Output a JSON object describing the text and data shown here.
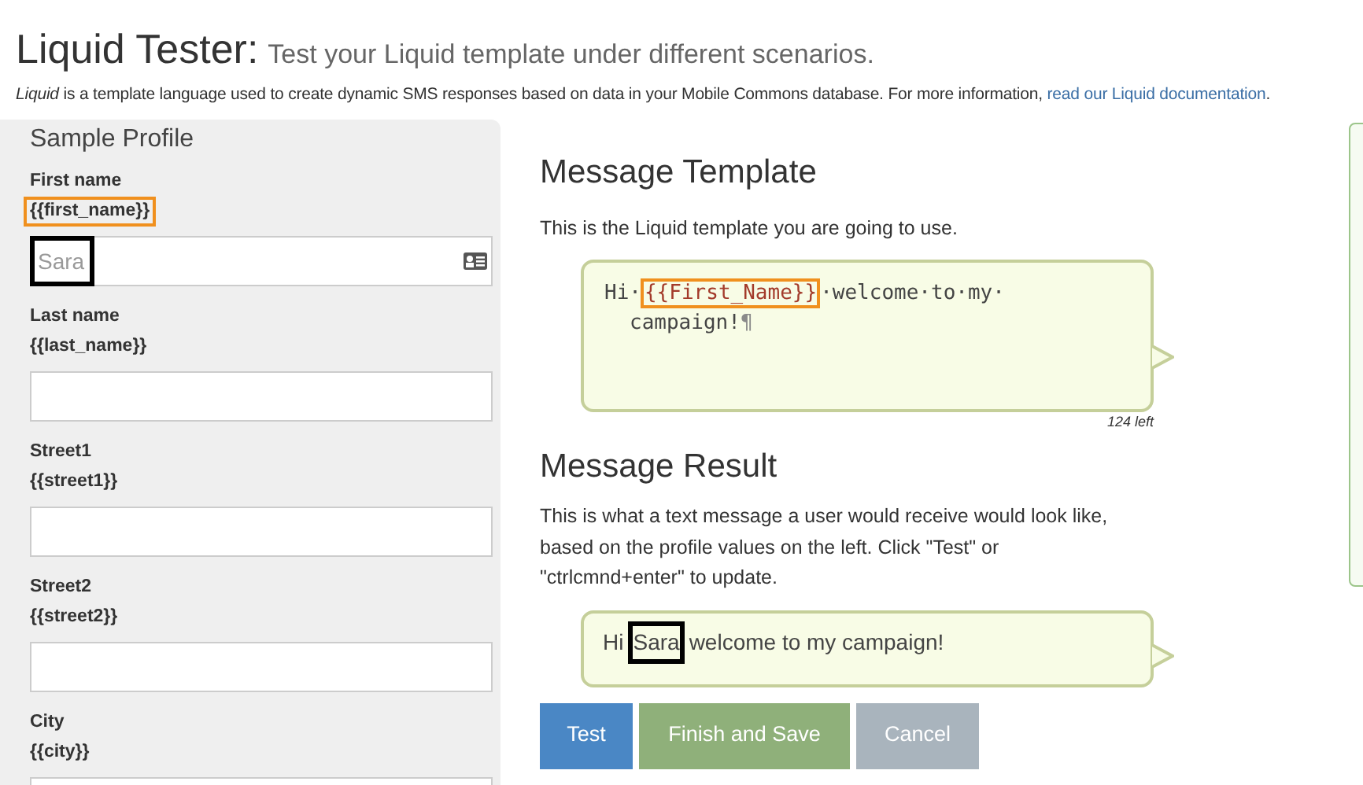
{
  "header": {
    "title": "Liquid Tester:",
    "subtitle": "Test your Liquid template under different scenarios."
  },
  "intro": {
    "lead": "Liquid",
    "text": " is a template language used to create dynamic SMS responses based on data in your Mobile Commons database. For more information, ",
    "link": "read our Liquid documentation",
    "end": "."
  },
  "profile": {
    "title": "Sample Profile",
    "fields": [
      {
        "label": "First name",
        "variable": "{{first_name}}",
        "variable_highlighted": true,
        "placeholder": "Sara",
        "placeholder_highlighted": true,
        "contact_icon": true
      },
      {
        "label": "Last name",
        "variable": "{{last_name}}",
        "variable_highlighted": false
      },
      {
        "label": "Street1",
        "variable": "{{street1}}",
        "variable_highlighted": false
      },
      {
        "label": "Street2",
        "variable": "{{street2}}",
        "variable_highlighted": false
      },
      {
        "label": "City",
        "variable": "{{city}}",
        "variable_highlighted": false
      }
    ]
  },
  "template": {
    "title": "Message Template",
    "description": "This is the Liquid template you are going to use.",
    "lines": [
      [
        {
          "text": "Hi·"
        },
        {
          "text": "{{First_Name}}",
          "kind": "variable",
          "highlighted": true
        },
        {
          "text": "·welcome·to·my·"
        }
      ],
      [
        {
          "text": "campaign!"
        },
        {
          "text": "¶",
          "kind": "mark"
        }
      ]
    ],
    "counter": "124 left"
  },
  "result": {
    "title": "Message Result",
    "description": "This is what a text message a user would receive would look like, based on the profile values on the left. Click \"Test\" or \"ctrlcmnd+enter\" to update.",
    "segments": [
      {
        "text": "Hi"
      },
      {
        "text": "Sara",
        "highlighted": true
      },
      {
        "text": "welcome to my campaign!"
      }
    ]
  },
  "buttons": [
    {
      "label": "Test",
      "kind": "primary"
    },
    {
      "label": "Finish and Save",
      "kind": "success"
    },
    {
      "label": "Cancel",
      "kind": "neutral"
    }
  ]
}
